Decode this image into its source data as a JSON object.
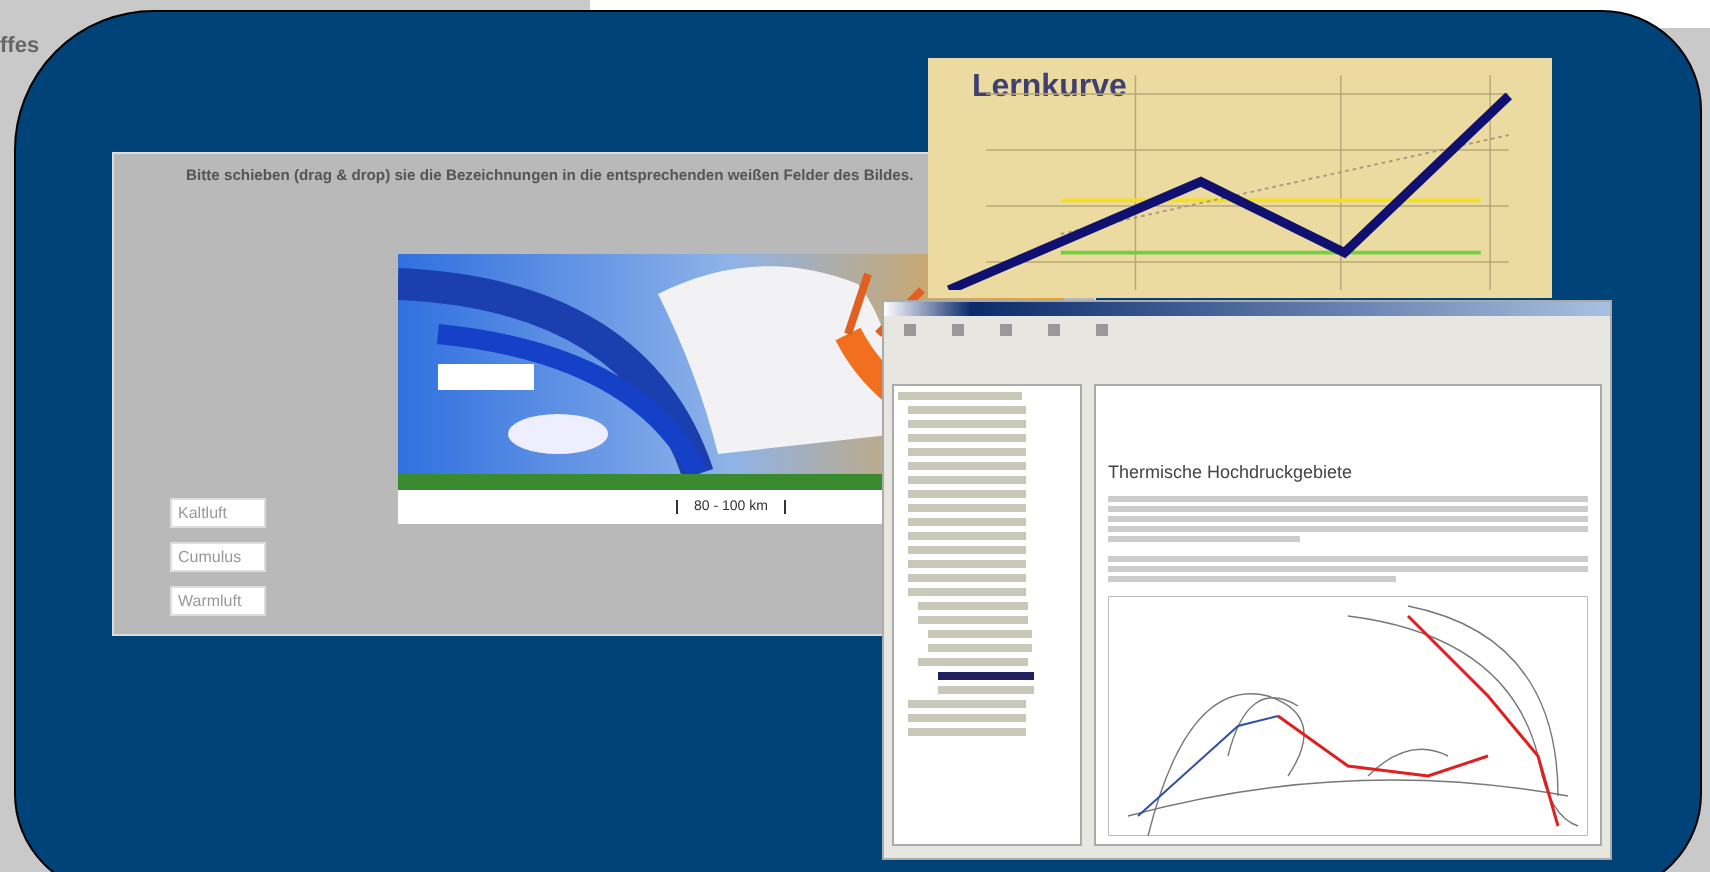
{
  "page": {
    "cut_text": "ffes"
  },
  "drag_exercise": {
    "instruction": "Bitte schieben (drag & drop) sie die Bezeichnungen in die entsprechenden weißen Felder des Bildes.",
    "labels": [
      "Kaltluft",
      "Cumulus",
      "Warmluft"
    ],
    "distance": "80 - 100 km"
  },
  "learning_curve": {
    "title": "Lernkurve"
  },
  "help_window": {
    "heading": "Thermische Hochdruckgebiete"
  }
}
